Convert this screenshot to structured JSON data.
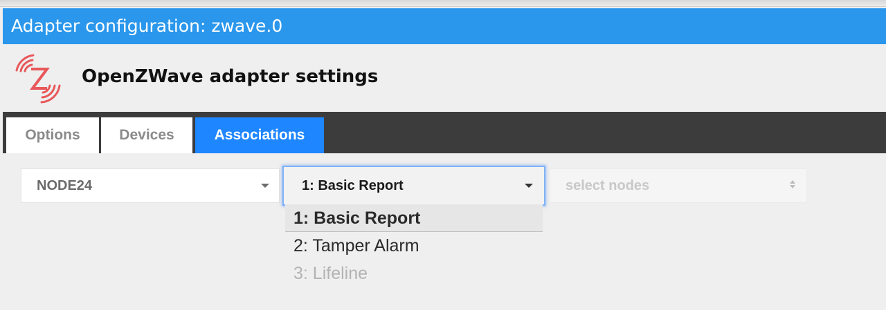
{
  "window": {
    "title": "Adapter configuration: zwave.0"
  },
  "header": {
    "logo_icon": "zwave-logo-icon",
    "title": "OpenZWave adapter settings"
  },
  "tabs": [
    {
      "label": "Options",
      "active": false
    },
    {
      "label": "Devices",
      "active": false
    },
    {
      "label": "Associations",
      "active": true
    }
  ],
  "associations": {
    "node_select": {
      "value": "NODE24"
    },
    "group_select": {
      "value": "1: Basic Report",
      "options": [
        {
          "label": "1: Basic Report",
          "selected": true,
          "disabled": false
        },
        {
          "label": "2: Tamper Alarm",
          "selected": false,
          "disabled": false
        },
        {
          "label": "3: Lifeline",
          "selected": false,
          "disabled": true
        }
      ]
    },
    "nodes_select": {
      "placeholder": "select nodes",
      "disabled": true
    }
  },
  "colors": {
    "titlebar": "#2a97ec",
    "active_tab": "#1e86ff",
    "tabbar": "#3c3c3c",
    "logo": "#e8585a"
  }
}
